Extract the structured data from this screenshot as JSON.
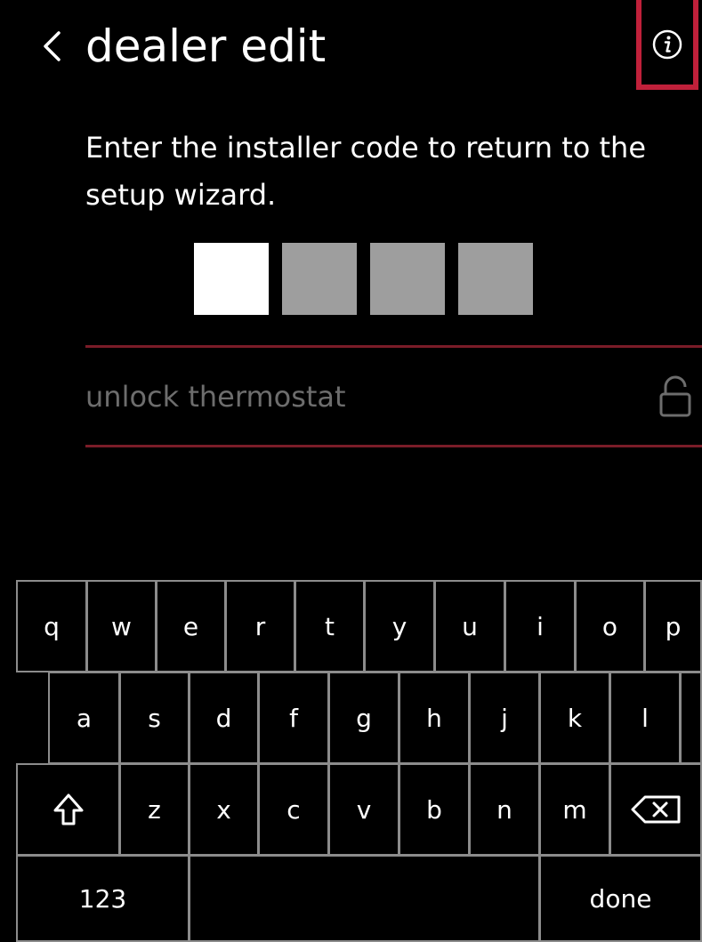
{
  "header": {
    "title": "dealer edit",
    "back_icon": "chevron-left-icon",
    "info_icon": "info-icon",
    "highlight_color": "#c0203a"
  },
  "instruction": {
    "text": "Enter the installer code to return to the setup wizard."
  },
  "pin": {
    "length": 4,
    "active_index": 0
  },
  "unlock": {
    "label": "unlock thermostat",
    "icon": "lock-icon"
  },
  "keyboard": {
    "row1": [
      "q",
      "w",
      "e",
      "r",
      "t",
      "y",
      "u",
      "i",
      "o",
      "p"
    ],
    "row2": [
      "a",
      "s",
      "d",
      "f",
      "g",
      "h",
      "j",
      "k",
      "l"
    ],
    "row3_letters": [
      "z",
      "x",
      "c",
      "v",
      "b",
      "n",
      "m"
    ],
    "shift_icon": "shift-arrow-icon",
    "backspace_icon": "backspace-icon",
    "numbers_label": "123",
    "done_label": "done"
  },
  "colors": {
    "background": "#000000",
    "text": "#ffffff",
    "muted_text": "#6d6d6d",
    "divider": "#7a1c28",
    "pin_empty": "#9e9e9e",
    "pin_active": "#ffffff",
    "key_border": "#8c8c8c"
  }
}
